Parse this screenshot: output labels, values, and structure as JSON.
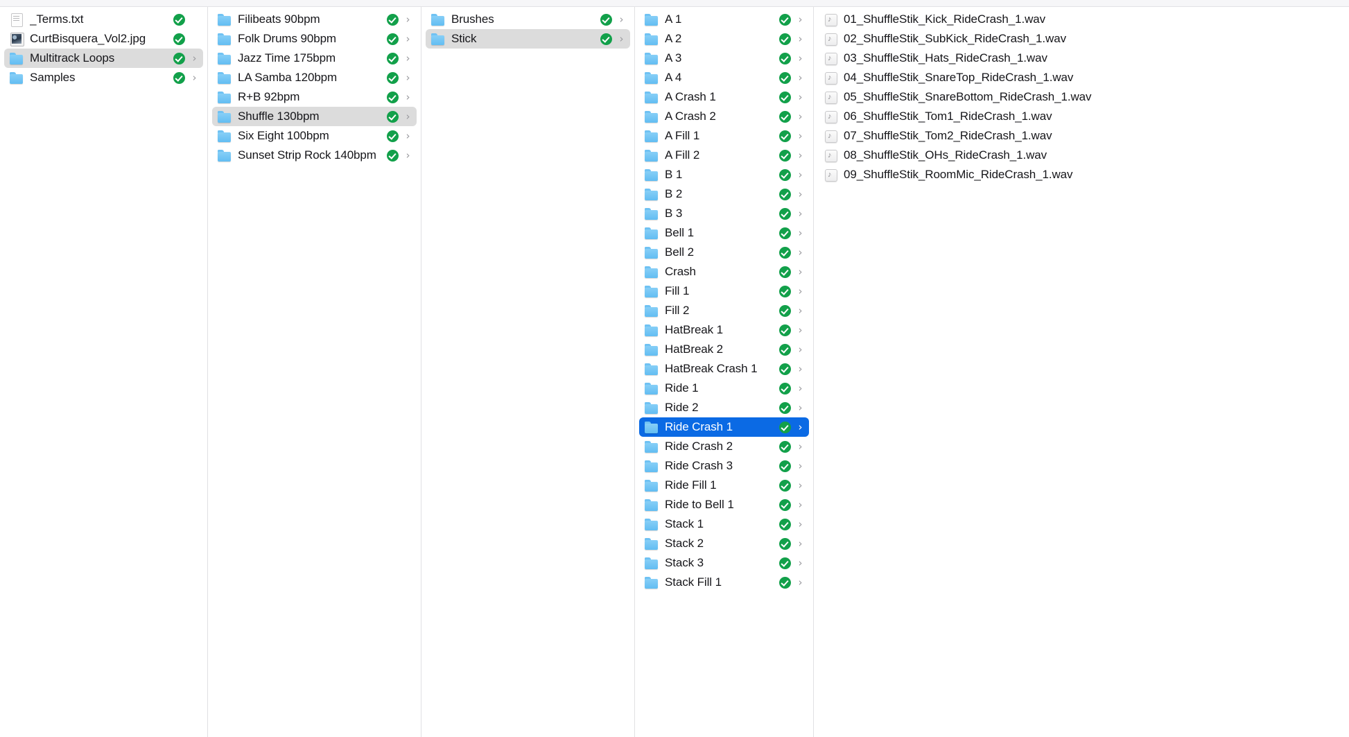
{
  "window": {
    "view": "column",
    "accent_selected_color": "#0b6ae4",
    "inactive_selected_color": "#dcdcdc",
    "badge_color": "#12a04a",
    "chevron_glyph": "›"
  },
  "columns": [
    {
      "name": "column-root",
      "items": [
        {
          "label": "_Terms.txt",
          "icon": "document-icon",
          "badge": true,
          "chevron": false,
          "selected": "none"
        },
        {
          "label": "CurtBisquera_Vol2.jpg",
          "icon": "image-icon",
          "badge": true,
          "chevron": false,
          "selected": "none"
        },
        {
          "label": "Multitrack Loops",
          "icon": "folder-icon",
          "badge": true,
          "chevron": true,
          "selected": "inactive"
        },
        {
          "label": "Samples",
          "icon": "folder-icon",
          "badge": true,
          "chevron": true,
          "selected": "none"
        }
      ]
    },
    {
      "name": "column-multitrack-loops",
      "items": [
        {
          "label": "Filibeats 90bpm",
          "icon": "folder-icon",
          "badge": true,
          "chevron": true,
          "selected": "none"
        },
        {
          "label": "Folk Drums 90bpm",
          "icon": "folder-icon",
          "badge": true,
          "chevron": true,
          "selected": "none"
        },
        {
          "label": "Jazz Time 175bpm",
          "icon": "folder-icon",
          "badge": true,
          "chevron": true,
          "selected": "none"
        },
        {
          "label": "LA Samba 120bpm",
          "icon": "folder-icon",
          "badge": true,
          "chevron": true,
          "selected": "none"
        },
        {
          "label": "R+B 92bpm",
          "icon": "folder-icon",
          "badge": true,
          "chevron": true,
          "selected": "none"
        },
        {
          "label": "Shuffle 130bpm",
          "icon": "folder-icon",
          "badge": true,
          "chevron": true,
          "selected": "inactive"
        },
        {
          "label": "Six Eight 100bpm",
          "icon": "folder-icon",
          "badge": true,
          "chevron": true,
          "selected": "none"
        },
        {
          "label": "Sunset Strip Rock 140bpm",
          "icon": "folder-icon",
          "badge": true,
          "chevron": true,
          "selected": "none"
        }
      ]
    },
    {
      "name": "column-shuffle-130bpm",
      "items": [
        {
          "label": "Brushes",
          "icon": "folder-icon",
          "badge": true,
          "chevron": true,
          "selected": "none"
        },
        {
          "label": "Stick",
          "icon": "folder-icon",
          "badge": true,
          "chevron": true,
          "selected": "inactive"
        }
      ]
    },
    {
      "name": "column-stick",
      "items": [
        {
          "label": "A 1",
          "icon": "folder-icon",
          "badge": true,
          "chevron": true,
          "selected": "none"
        },
        {
          "label": "A 2",
          "icon": "folder-icon",
          "badge": true,
          "chevron": true,
          "selected": "none"
        },
        {
          "label": "A 3",
          "icon": "folder-icon",
          "badge": true,
          "chevron": true,
          "selected": "none"
        },
        {
          "label": "A 4",
          "icon": "folder-icon",
          "badge": true,
          "chevron": true,
          "selected": "none"
        },
        {
          "label": "A Crash 1",
          "icon": "folder-icon",
          "badge": true,
          "chevron": true,
          "selected": "none"
        },
        {
          "label": "A Crash 2",
          "icon": "folder-icon",
          "badge": true,
          "chevron": true,
          "selected": "none"
        },
        {
          "label": "A Fill 1",
          "icon": "folder-icon",
          "badge": true,
          "chevron": true,
          "selected": "none"
        },
        {
          "label": "A Fill 2",
          "icon": "folder-icon",
          "badge": true,
          "chevron": true,
          "selected": "none"
        },
        {
          "label": "B 1",
          "icon": "folder-icon",
          "badge": true,
          "chevron": true,
          "selected": "none"
        },
        {
          "label": "B 2",
          "icon": "folder-icon",
          "badge": true,
          "chevron": true,
          "selected": "none"
        },
        {
          "label": "B 3",
          "icon": "folder-icon",
          "badge": true,
          "chevron": true,
          "selected": "none"
        },
        {
          "label": "Bell 1",
          "icon": "folder-icon",
          "badge": true,
          "chevron": true,
          "selected": "none"
        },
        {
          "label": "Bell 2",
          "icon": "folder-icon",
          "badge": true,
          "chevron": true,
          "selected": "none"
        },
        {
          "label": "Crash",
          "icon": "folder-icon",
          "badge": true,
          "chevron": true,
          "selected": "none"
        },
        {
          "label": "Fill 1",
          "icon": "folder-icon",
          "badge": true,
          "chevron": true,
          "selected": "none"
        },
        {
          "label": "Fill 2",
          "icon": "folder-icon",
          "badge": true,
          "chevron": true,
          "selected": "none"
        },
        {
          "label": "HatBreak 1",
          "icon": "folder-icon",
          "badge": true,
          "chevron": true,
          "selected": "none"
        },
        {
          "label": "HatBreak 2",
          "icon": "folder-icon",
          "badge": true,
          "chevron": true,
          "selected": "none"
        },
        {
          "label": "HatBreak Crash 1",
          "icon": "folder-icon",
          "badge": true,
          "chevron": true,
          "selected": "none"
        },
        {
          "label": "Ride 1",
          "icon": "folder-icon",
          "badge": true,
          "chevron": true,
          "selected": "none"
        },
        {
          "label": "Ride 2",
          "icon": "folder-icon",
          "badge": true,
          "chevron": true,
          "selected": "none"
        },
        {
          "label": "Ride Crash 1",
          "icon": "folder-icon",
          "badge": true,
          "chevron": true,
          "selected": "active"
        },
        {
          "label": "Ride Crash 2",
          "icon": "folder-icon",
          "badge": true,
          "chevron": true,
          "selected": "none"
        },
        {
          "label": "Ride Crash 3",
          "icon": "folder-icon",
          "badge": true,
          "chevron": true,
          "selected": "none"
        },
        {
          "label": "Ride Fill 1",
          "icon": "folder-icon",
          "badge": true,
          "chevron": true,
          "selected": "none"
        },
        {
          "label": "Ride to Bell 1",
          "icon": "folder-icon",
          "badge": true,
          "chevron": true,
          "selected": "none"
        },
        {
          "label": "Stack 1",
          "icon": "folder-icon",
          "badge": true,
          "chevron": true,
          "selected": "none"
        },
        {
          "label": "Stack 2",
          "icon": "folder-icon",
          "badge": true,
          "chevron": true,
          "selected": "none"
        },
        {
          "label": "Stack 3",
          "icon": "folder-icon",
          "badge": true,
          "chevron": true,
          "selected": "none"
        },
        {
          "label": "Stack Fill 1",
          "icon": "folder-icon",
          "badge": true,
          "chevron": true,
          "selected": "none"
        }
      ]
    },
    {
      "name": "column-ride-crash-1",
      "items": [
        {
          "label": "01_ShuffleStik_Kick_RideCrash_1.wav",
          "icon": "audio-icon",
          "badge": false,
          "chevron": false,
          "selected": "none"
        },
        {
          "label": "02_ShuffleStik_SubKick_RideCrash_1.wav",
          "icon": "audio-icon",
          "badge": false,
          "chevron": false,
          "selected": "none"
        },
        {
          "label": "03_ShuffleStik_Hats_RideCrash_1.wav",
          "icon": "audio-icon",
          "badge": false,
          "chevron": false,
          "selected": "none"
        },
        {
          "label": "04_ShuffleStik_SnareTop_RideCrash_1.wav",
          "icon": "audio-icon",
          "badge": false,
          "chevron": false,
          "selected": "none"
        },
        {
          "label": "05_ShuffleStik_SnareBottom_RideCrash_1.wav",
          "icon": "audio-icon",
          "badge": false,
          "chevron": false,
          "selected": "none"
        },
        {
          "label": "06_ShuffleStik_Tom1_RideCrash_1.wav",
          "icon": "audio-icon",
          "badge": false,
          "chevron": false,
          "selected": "none"
        },
        {
          "label": "07_ShuffleStik_Tom2_RideCrash_1.wav",
          "icon": "audio-icon",
          "badge": false,
          "chevron": false,
          "selected": "none"
        },
        {
          "label": "08_ShuffleStik_OHs_RideCrash_1.wav",
          "icon": "audio-icon",
          "badge": false,
          "chevron": false,
          "selected": "none"
        },
        {
          "label": "09_ShuffleStik_RoomMic_RideCrash_1.wav",
          "icon": "audio-icon",
          "badge": false,
          "chevron": false,
          "selected": "none"
        }
      ]
    }
  ]
}
